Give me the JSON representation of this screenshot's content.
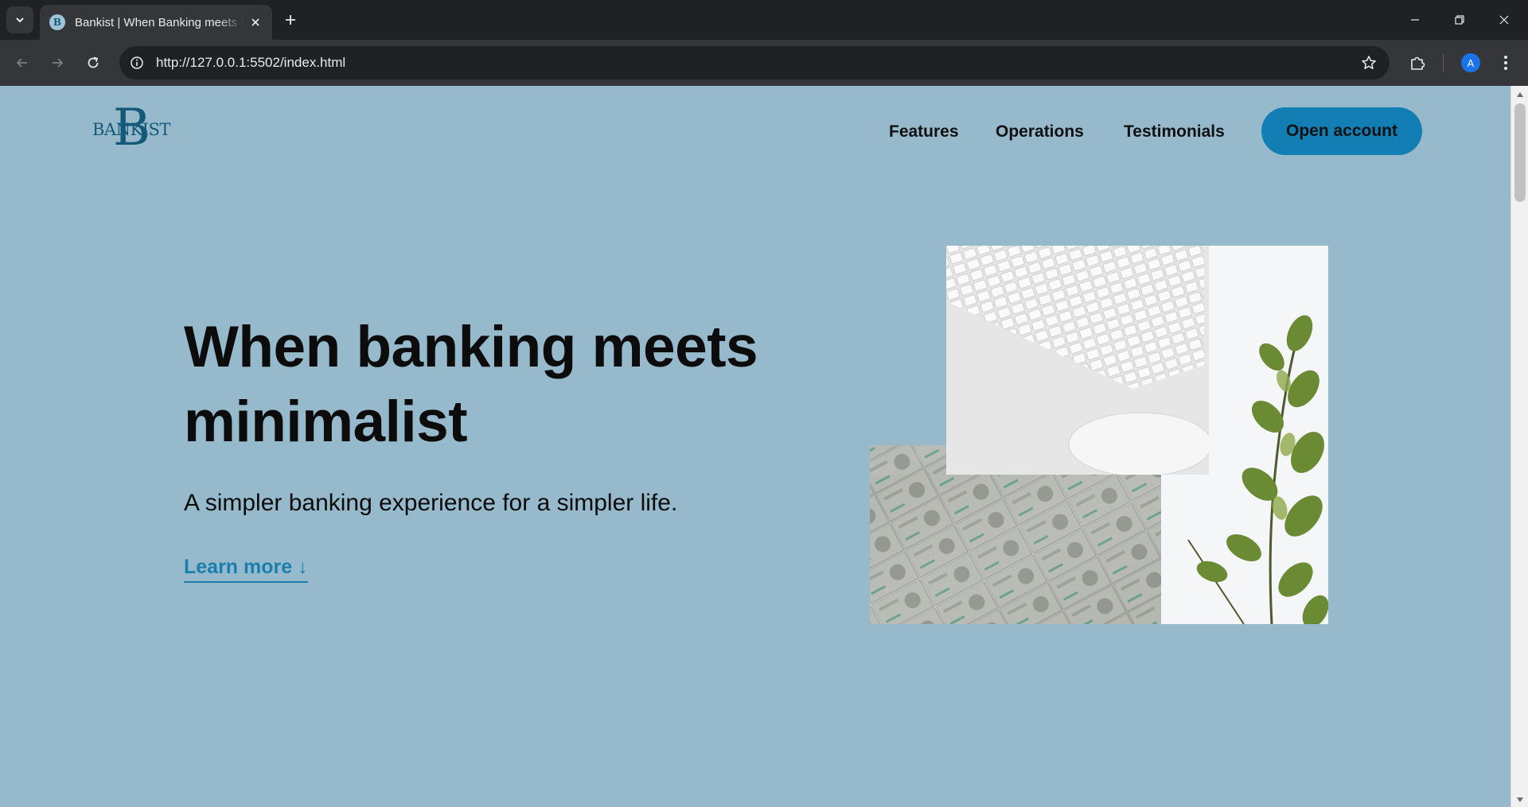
{
  "browser": {
    "tab_title": "Bankist | When Banking meets Minimalist",
    "url": "http://127.0.0.1:5502/index.html",
    "profile_initial": "A"
  },
  "page": {
    "logo": {
      "initial": "B",
      "word": "BANKIST"
    },
    "nav": {
      "features": "Features",
      "operations": "Operations",
      "testimonials": "Testimonials",
      "open_account": "Open account"
    },
    "hero": {
      "title": "When banking meets minimalist",
      "subtitle": "A simpler banking experience for a simpler life.",
      "learn_more": "Learn more ↓"
    }
  },
  "colors": {
    "page_background": "#96b9cb",
    "accent": "#127eb4",
    "link": "#1a7fae",
    "logo": "#145a78"
  }
}
